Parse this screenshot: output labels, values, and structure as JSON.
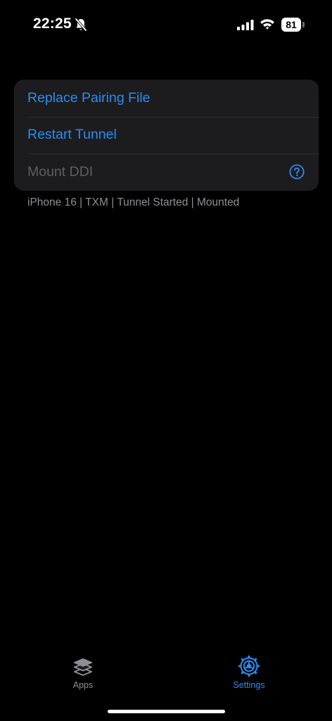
{
  "status_bar": {
    "time": "22:25",
    "battery_level": "81",
    "icons": [
      "bell-slash-icon",
      "cellular-signal-icon",
      "wifi-icon",
      "battery-icon"
    ]
  },
  "settings": {
    "rows": [
      {
        "label": "Replace Pairing File",
        "enabled": true
      },
      {
        "label": "Restart Tunnel",
        "enabled": true
      },
      {
        "label": "Mount DDI",
        "enabled": false,
        "accessory_icon": "question-circle-icon"
      }
    ],
    "footer": "iPhone 16 | TXM | Tunnel Started | Mounted"
  },
  "tab_bar": {
    "tabs": [
      {
        "label": "Apps",
        "icon": "stack-icon",
        "selected": false
      },
      {
        "label": "Settings",
        "icon": "gear-icon",
        "selected": true
      }
    ]
  },
  "colors": {
    "background": "#000000",
    "card": "#1c1c1e",
    "accent": "#2a8cf0",
    "disabled_text": "#5e5e62",
    "secondary_text": "#8e8e93"
  }
}
